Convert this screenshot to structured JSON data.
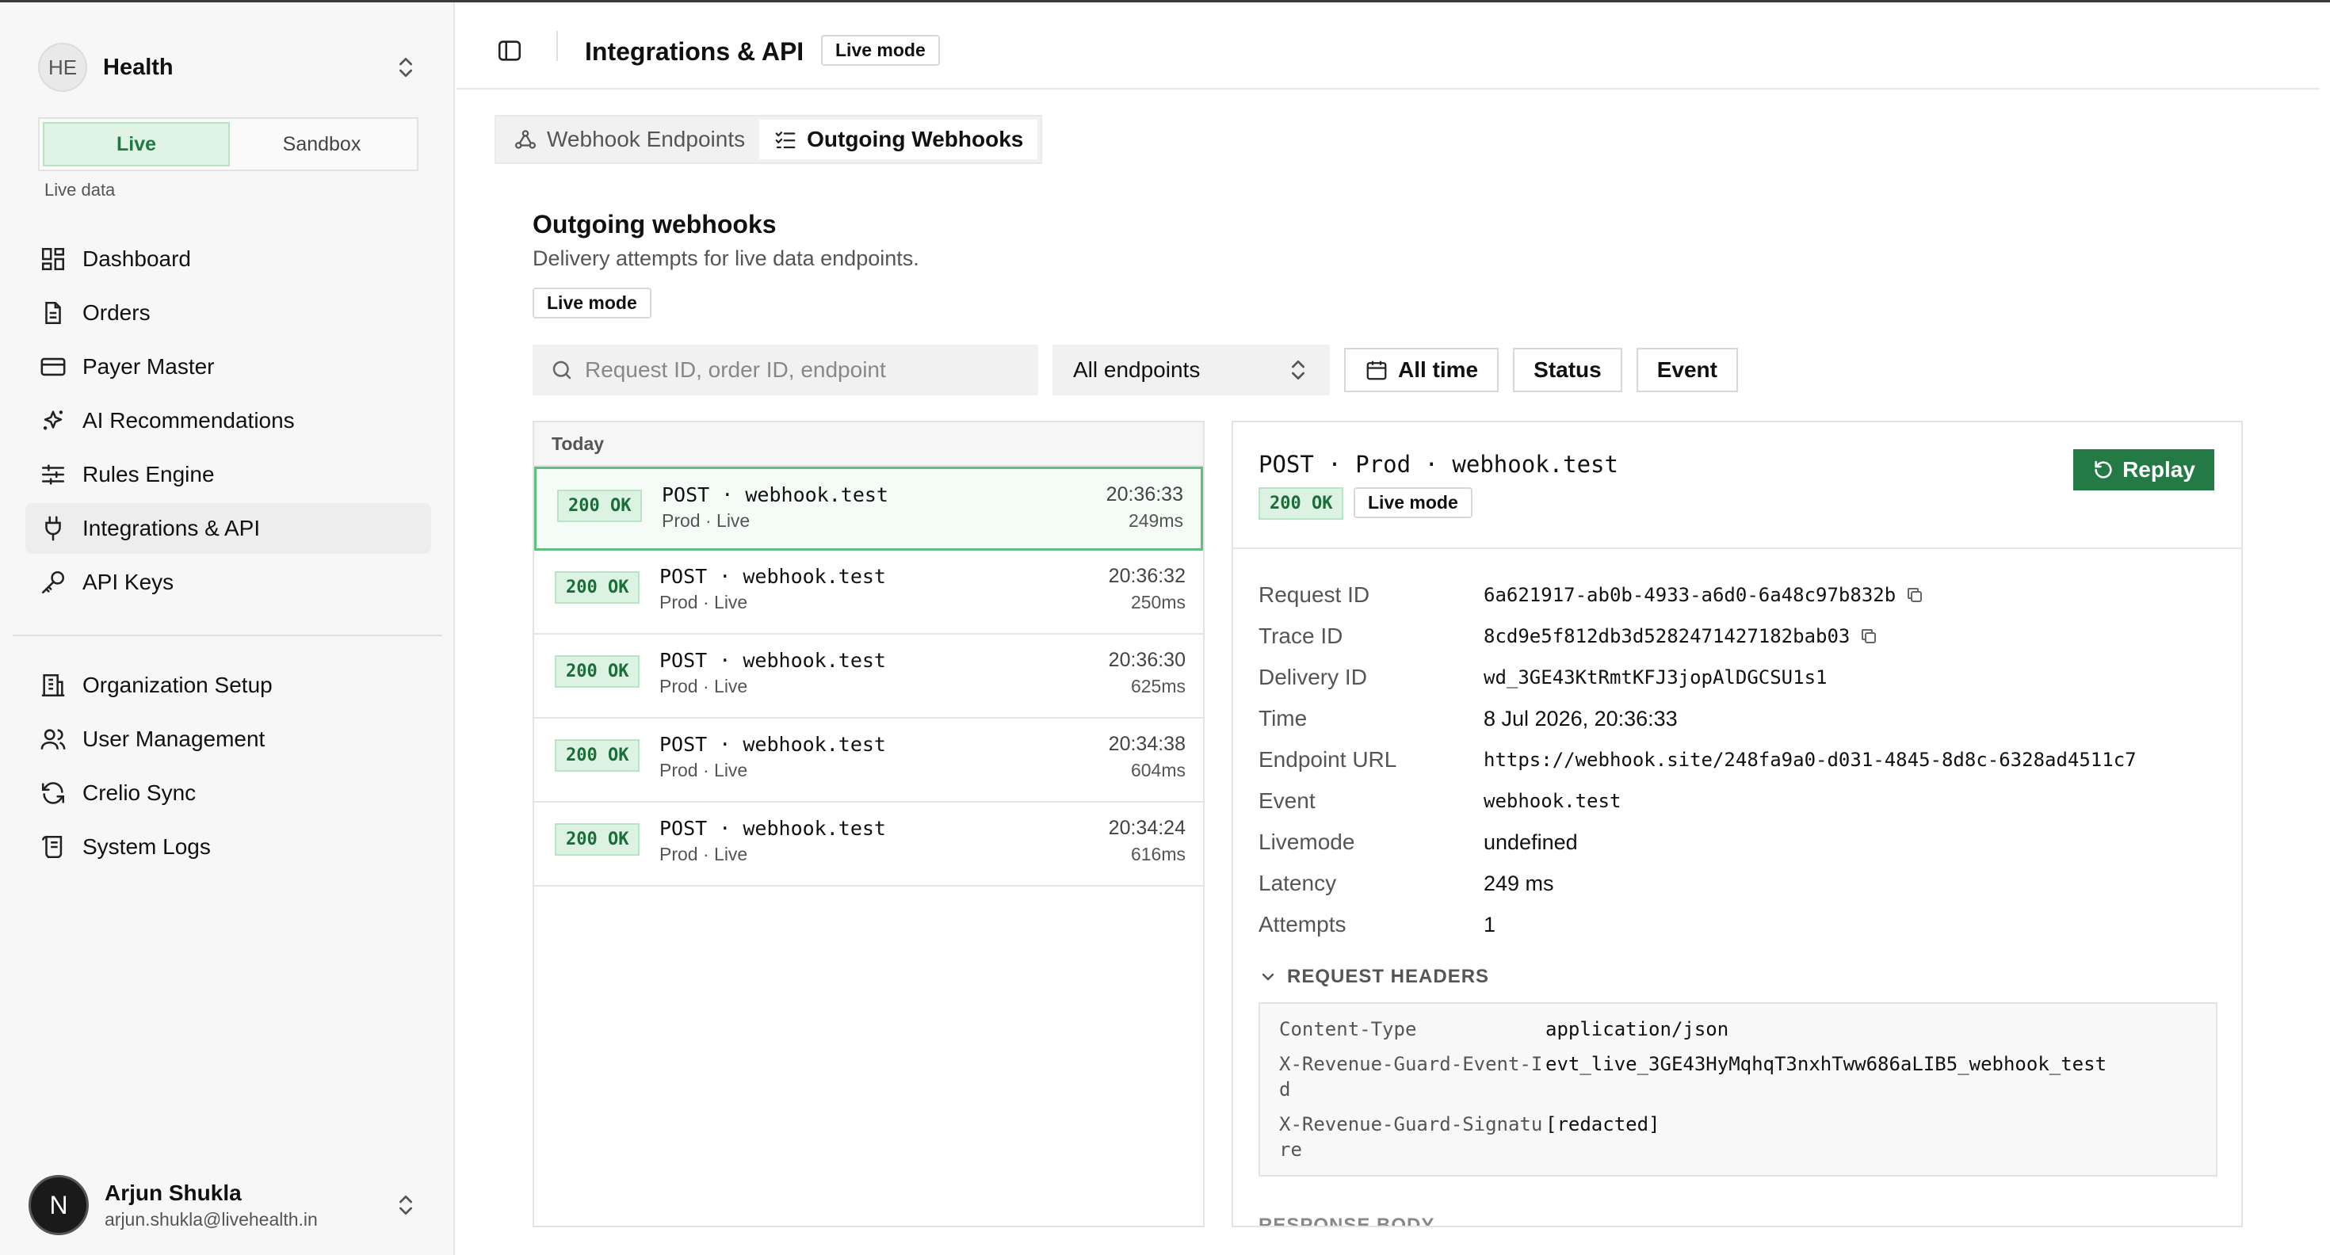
{
  "org": {
    "initials": "HE",
    "name": "Health"
  },
  "mode_toggle": {
    "live": "Live",
    "sandbox": "Sandbox",
    "caption": "Live data"
  },
  "nav_primary": [
    {
      "label": "Dashboard"
    },
    {
      "label": "Orders"
    },
    {
      "label": "Payer Master"
    },
    {
      "label": "AI Recommendations"
    },
    {
      "label": "Rules Engine"
    },
    {
      "label": "Integrations & API"
    },
    {
      "label": "API Keys"
    }
  ],
  "nav_secondary": [
    {
      "label": "Organization Setup"
    },
    {
      "label": "User Management"
    },
    {
      "label": "Crelio Sync"
    },
    {
      "label": "System Logs"
    }
  ],
  "user": {
    "initial": "N",
    "name": "Arjun Shukla",
    "email": "arjun.shukla@livehealth.in"
  },
  "header": {
    "title": "Integrations & API",
    "badge": "Live mode"
  },
  "tabs": [
    {
      "label": "Webhook Endpoints"
    },
    {
      "label": "Outgoing Webhooks"
    }
  ],
  "section": {
    "title": "Outgoing webhooks",
    "subtitle": "Delivery attempts for live data endpoints.",
    "badge": "Live mode"
  },
  "filters": {
    "search_placeholder": "Request ID, order ID, endpoint",
    "endpoint_select": "All endpoints",
    "time": "All time",
    "status": "Status",
    "event": "Event"
  },
  "list": {
    "group": "Today",
    "rows": [
      {
        "status": "200 OK",
        "title": "POST · webhook.test",
        "sub": "Prod · Live",
        "time": "20:36:33",
        "latency": "249ms"
      },
      {
        "status": "200 OK",
        "title": "POST · webhook.test",
        "sub": "Prod · Live",
        "time": "20:36:32",
        "latency": "250ms"
      },
      {
        "status": "200 OK",
        "title": "POST · webhook.test",
        "sub": "Prod · Live",
        "time": "20:36:30",
        "latency": "625ms"
      },
      {
        "status": "200 OK",
        "title": "POST · webhook.test",
        "sub": "Prod · Live",
        "time": "20:34:38",
        "latency": "604ms"
      },
      {
        "status": "200 OK",
        "title": "POST · webhook.test",
        "sub": "Prod · Live",
        "time": "20:34:24",
        "latency": "616ms"
      }
    ]
  },
  "detail": {
    "title": "POST · Prod · webhook.test",
    "status": "200 OK",
    "badge": "Live mode",
    "replay": "Replay",
    "fields": {
      "request_id": {
        "label": "Request ID",
        "value": "6a621917-ab0b-4933-a6d0-6a48c97b832b"
      },
      "trace_id": {
        "label": "Trace ID",
        "value": "8cd9e5f812db3d5282471427182bab03"
      },
      "delivery_id": {
        "label": "Delivery ID",
        "value": "wd_3GE43KtRmtKFJ3jopAlDGCSU1s1"
      },
      "time": {
        "label": "Time",
        "value": "8 Jul 2026, 20:36:33"
      },
      "endpoint_url": {
        "label": "Endpoint URL",
        "value": "https://webhook.site/248fa9a0-d031-4845-8d8c-6328ad4511c7"
      },
      "event": {
        "label": "Event",
        "value": "webhook.test"
      },
      "livemode": {
        "label": "Livemode",
        "value": "undefined"
      },
      "latency": {
        "label": "Latency",
        "value": "249 ms"
      },
      "attempts": {
        "label": "Attempts",
        "value": "1"
      }
    },
    "request_headers_label": "REQUEST HEADERS",
    "request_headers": [
      {
        "key": "Content-Type",
        "value": "application/json"
      },
      {
        "key": "X-Revenue-Guard-Event-Id",
        "value": "evt_live_3GE43HyMqhqT3nxhTww686aLIB5_webhook_test"
      },
      {
        "key": "X-Revenue-Guard-Signature",
        "value": "[redacted]"
      }
    ],
    "next_section_label": "RESPONSE BODY"
  },
  "icons": {
    "dashboard": "grid-icon",
    "orders": "document-icon",
    "payer": "card-icon",
    "ai": "sparkles-icon",
    "rules": "sliders-icon",
    "integrations": "plug-icon",
    "api_keys": "key-icon",
    "org_setup": "building-icon",
    "users": "users-icon",
    "sync": "refresh-icon",
    "logs": "scroll-icon"
  },
  "colors": {
    "accent_green": "#237a45",
    "status_ok_bg": "#dcf3e3",
    "status_ok_text": "#1b6e3a",
    "selected_border": "#5fbf83"
  }
}
